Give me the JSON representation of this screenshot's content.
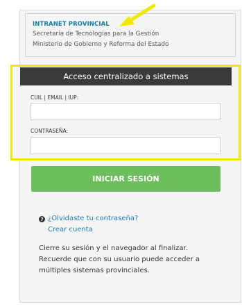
{
  "org": {
    "title": "INTRANET PROVINCIAL",
    "line1": "Secretaría de Tecnologías para la Gestión",
    "line2": "Ministerio de Gobierno y Reforma del Estado"
  },
  "login": {
    "header": "Acceso centralizado a sistemas",
    "user_label": "CUIL | EMAIL | IUP:",
    "user_value": "",
    "password_label": "CONTRASEÑA:",
    "password_value": "",
    "submit_label": "INICIAR SESIÓN"
  },
  "links": {
    "forgot_password": "¿Olvidaste tu contraseña?",
    "create_account": "Crear cuenta"
  },
  "notes": {
    "line1": "Cierre su sesión y el navegador al finalizar.",
    "line2": "Recuerde que con su usuario puede acceder a",
    "line3": "múltiples sistemas provinciales."
  },
  "icons": {
    "help": "question-circle-icon",
    "annotation_arrow": "arrow-icon"
  },
  "colors": {
    "header_bg": "#3a3a3a",
    "button_bg": "#6cbf5c",
    "link": "#1f7ab3",
    "title": "#0e7fa8",
    "highlight": "#f0e800"
  }
}
